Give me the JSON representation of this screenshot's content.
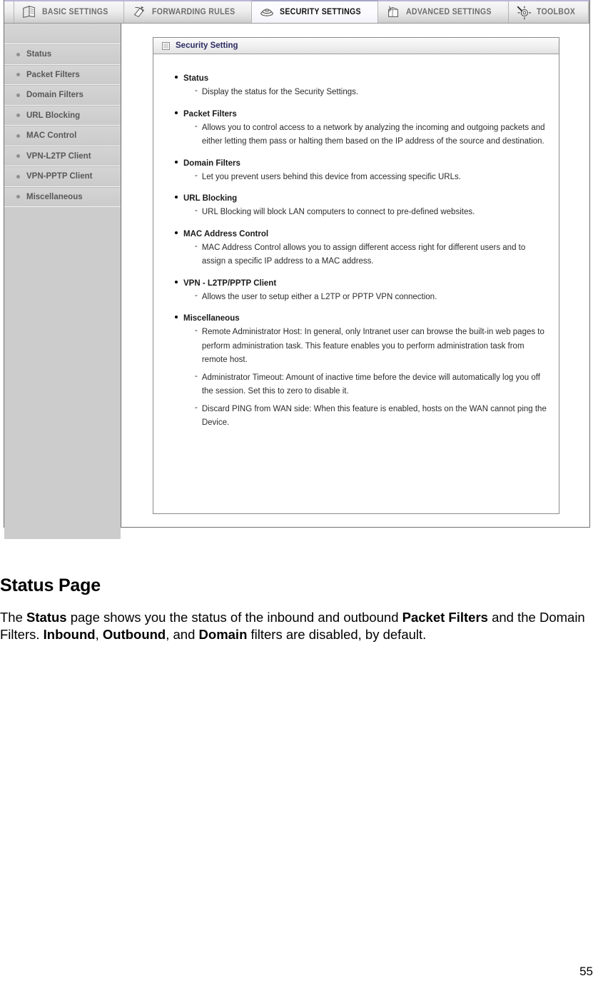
{
  "screenshot": {
    "tabs": [
      {
        "label": "BASIC SETTINGS",
        "icon": "documents-icon",
        "active": false
      },
      {
        "label": "FORWARDING RULES",
        "icon": "arrow-pages-icon",
        "active": false
      },
      {
        "label": "SECURITY SETTINGS",
        "icon": "shield-stack-icon",
        "active": true
      },
      {
        "label": "ADVANCED SETTINGS",
        "icon": "box-tools-icon",
        "active": false
      },
      {
        "label": "TOOLBOX",
        "icon": "gear-wrench-icon",
        "active": false
      }
    ],
    "sidebar": {
      "items": [
        {
          "label": "Status"
        },
        {
          "label": "Packet Filters"
        },
        {
          "label": "Domain Filters"
        },
        {
          "label": "URL Blocking"
        },
        {
          "label": "MAC Control"
        },
        {
          "label": "VPN-L2TP Client"
        },
        {
          "label": "VPN-PPTP Client"
        },
        {
          "label": "Miscellaneous"
        }
      ]
    },
    "panel": {
      "title": "Security Setting",
      "features": [
        {
          "name": "Status",
          "descriptions": [
            "Display the status for the Security Settings."
          ]
        },
        {
          "name": "Packet Filters",
          "descriptions": [
            "Allows you to control access to a network by analyzing the incoming and outgoing packets and either letting them pass or halting them based on the IP address of the source and destination."
          ]
        },
        {
          "name": "Domain Filters",
          "descriptions": [
            "Let you prevent users behind this device from accessing specific URLs."
          ]
        },
        {
          "name": "URL Blocking",
          "descriptions": [
            "URL Blocking will block LAN computers to connect to pre-defined websites."
          ]
        },
        {
          "name": "MAC Address Control",
          "descriptions": [
            "MAC Address Control allows you to assign different access right for different users and to assign a specific IP address to a MAC address."
          ]
        },
        {
          "name": "VPN - L2TP/PPTP Client",
          "descriptions": [
            "Allows the user to setup either a L2TP or PPTP VPN connection."
          ]
        },
        {
          "name": "Miscellaneous",
          "descriptions": [
            "Remote Administrator Host: In general, only Intranet user can browse the built-in web pages to perform administration task. This feature enables you to perform administration task from remote host.",
            "Administrator Timeout: Amount of inactive time before the device will automatically log you off the session. Set this to zero to disable it.",
            "Discard PING from WAN side: When this feature is enabled, hosts on the WAN cannot ping the Device."
          ]
        }
      ]
    }
  },
  "prose": {
    "heading": "Status Page",
    "paragraph_parts": [
      {
        "text": "The ",
        "bold": false
      },
      {
        "text": "Status",
        "bold": true
      },
      {
        "text": " page shows you the status of the inbound and outbound ",
        "bold": false
      },
      {
        "text": "Packet Filters",
        "bold": true
      },
      {
        "text": " and the Domain Filters. ",
        "bold": false
      },
      {
        "text": "Inbound",
        "bold": true
      },
      {
        "text": ", ",
        "bold": false
      },
      {
        "text": "Outbound",
        "bold": true
      },
      {
        "text": ", and ",
        "bold": false
      },
      {
        "text": "Domain",
        "bold": true
      },
      {
        "text": " filters are disabled, by default.",
        "bold": false
      }
    ]
  },
  "footer": {
    "page_number": "55"
  },
  "colors": {
    "panel_title": "#2c2c63",
    "sidebar_bg": "#cccccc",
    "tab_active_accent": "#a7a4c8"
  }
}
